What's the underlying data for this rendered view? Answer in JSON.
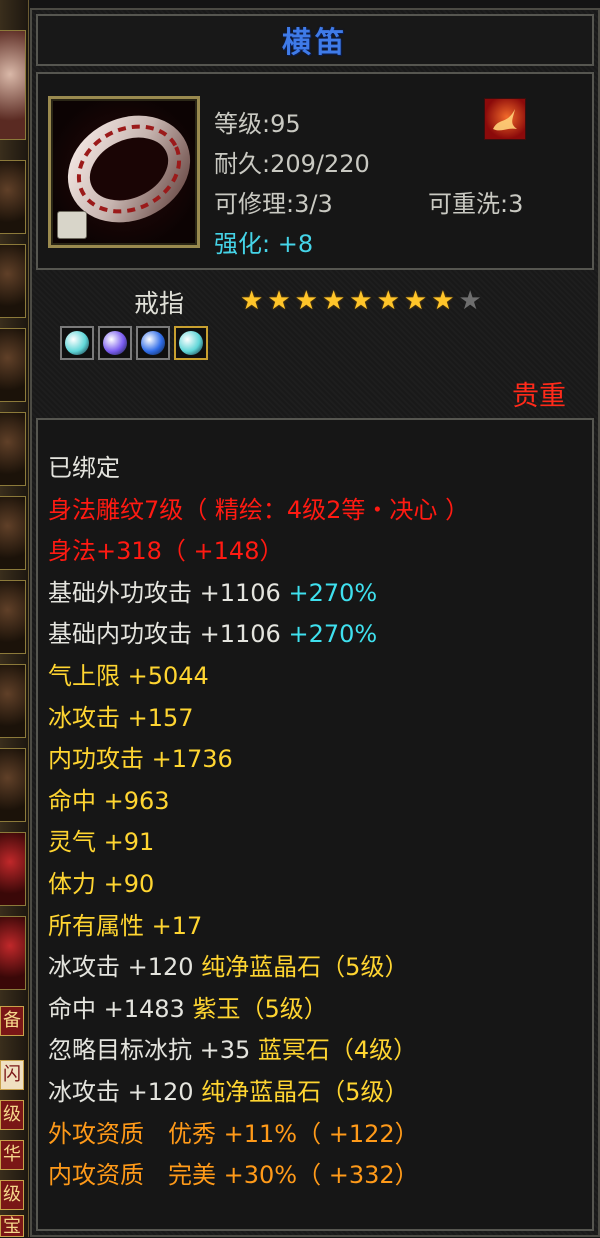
{
  "item": {
    "name": "横笛",
    "level": "等级:95",
    "durability": "耐久:209/220",
    "repairable": "可修理:3/3",
    "rewash": "可重洗:3",
    "enhance": "强化: +8",
    "type": "戒指",
    "stars_filled": 8,
    "stars_total": 9,
    "rarity": "贵重"
  },
  "gems": [
    {
      "icon": "cyan-gem-icon",
      "color": "#5fd6d8"
    },
    {
      "icon": "purple-gem-icon",
      "color": "#7a5cf0"
    },
    {
      "icon": "blue-gem-icon",
      "color": "#2f6ce8"
    },
    {
      "icon": "cyan-gem-icon",
      "color": "#5fd6d8",
      "highlight": true
    }
  ],
  "attributes": [
    {
      "parts": [
        {
          "text": "已绑定",
          "color": "white"
        }
      ]
    },
    {
      "parts": [
        {
          "text": "身法雕纹7级（ 精绘：4级2等・决心 ）",
          "color": "red"
        }
      ]
    },
    {
      "parts": [
        {
          "text": "身法+318（ +148）",
          "color": "red"
        }
      ]
    },
    {
      "parts": [
        {
          "text": "基础外功攻击 +1106 ",
          "color": "white"
        },
        {
          "text": "+270%",
          "color": "cyan"
        }
      ]
    },
    {
      "parts": [
        {
          "text": "基础内功攻击 +1106 ",
          "color": "white"
        },
        {
          "text": "+270%",
          "color": "cyan"
        }
      ]
    },
    {
      "parts": [
        {
          "text": "气上限 +5044",
          "color": "yellow"
        }
      ]
    },
    {
      "parts": [
        {
          "text": "冰攻击 +157",
          "color": "yellow"
        }
      ]
    },
    {
      "parts": [
        {
          "text": "内功攻击 +1736",
          "color": "yellow"
        }
      ]
    },
    {
      "parts": [
        {
          "text": "命中 +963",
          "color": "yellow"
        }
      ]
    },
    {
      "parts": [
        {
          "text": "灵气 +91",
          "color": "yellow"
        }
      ]
    },
    {
      "parts": [
        {
          "text": "体力 +90",
          "color": "yellow"
        }
      ]
    },
    {
      "parts": [
        {
          "text": "所有属性 +17",
          "color": "yellow"
        }
      ]
    },
    {
      "parts": [
        {
          "text": "冰攻击 +120 ",
          "color": "white"
        },
        {
          "text": "纯净蓝晶石（5级）",
          "color": "yellow"
        }
      ]
    },
    {
      "parts": [
        {
          "text": "命中 +1483 ",
          "color": "white"
        },
        {
          "text": "紫玉（5级）",
          "color": "yellow"
        }
      ]
    },
    {
      "parts": [
        {
          "text": "忽略目标冰抗 +35 ",
          "color": "white"
        },
        {
          "text": "蓝冥石（4级）",
          "color": "yellow"
        }
      ]
    },
    {
      "parts": [
        {
          "text": "冰攻击 +120 ",
          "color": "white"
        },
        {
          "text": "纯净蓝晶石（5级）",
          "color": "yellow"
        }
      ]
    },
    {
      "parts": [
        {
          "text": "外攻资质　优秀 +11%（ +122）",
          "color": "orange"
        }
      ]
    },
    {
      "parts": [
        {
          "text": "内攻资质　完美 +30%（ +332）",
          "color": "orange"
        }
      ]
    }
  ],
  "left_strip_tags": [
    "备",
    "闪",
    "级",
    "华",
    "级",
    "宝"
  ],
  "colors": {
    "title": "#3f7be8",
    "enhance": "#45d4e8",
    "rarity": "#ff2a1a",
    "white": "#e4e4de",
    "red": "#ff1a12",
    "yellow": "#ffd531",
    "orange": "#ff9a19",
    "cyan": "#3fe0ee"
  }
}
